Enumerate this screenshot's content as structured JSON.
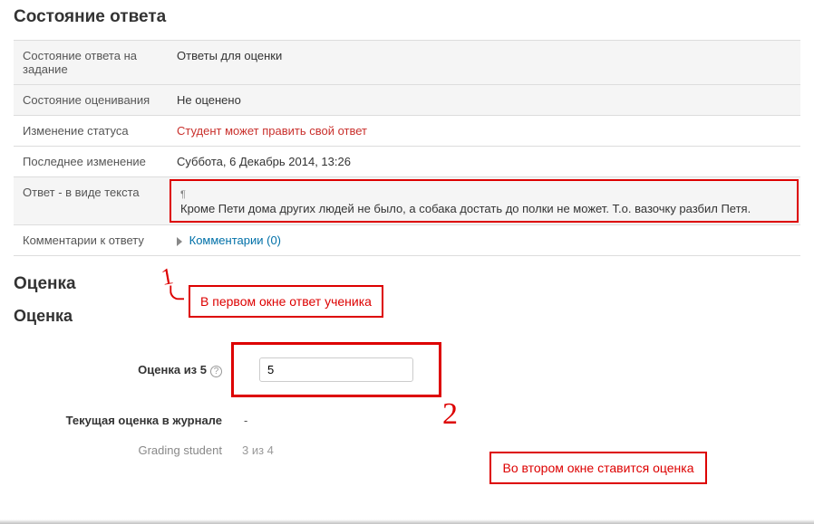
{
  "headers": {
    "status_title": "Состояние ответа",
    "grade_title": "Оценка",
    "grade_sub": "Оценка"
  },
  "rows": {
    "submission_status_label": "Состояние ответа на задание",
    "submission_status_value": "Ответы для оценки",
    "grading_status_label": "Состояние оценивания",
    "grading_status_value": "Не оценено",
    "status_change_label": "Изменение статуса",
    "status_change_value": "Студент может править свой ответ",
    "last_modified_label": "Последнее изменение",
    "last_modified_value": "Суббота, 6 Декабрь 2014, 13:26",
    "answer_text_label": "Ответ - в виде текста",
    "answer_text_value": "Кроме Пети дома других людей не было, а собака достать до полки не может. Т.о. вазочку разбил Петя.",
    "comments_label": "Комментарии к ответу",
    "comments_link": "Комментарии (0)"
  },
  "form": {
    "grade_out_of_label": "Оценка из 5",
    "grade_value": "5",
    "current_grade_label": "Текущая оценка в журнале",
    "current_grade_value": "-",
    "grading_student_label": "Grading student",
    "grading_student_value": "3 из 4"
  },
  "annotations": {
    "num1": "1",
    "num2": "2",
    "note1": "В первом окне ответ ученика",
    "note2": "Во втором окне ставится оценка"
  }
}
